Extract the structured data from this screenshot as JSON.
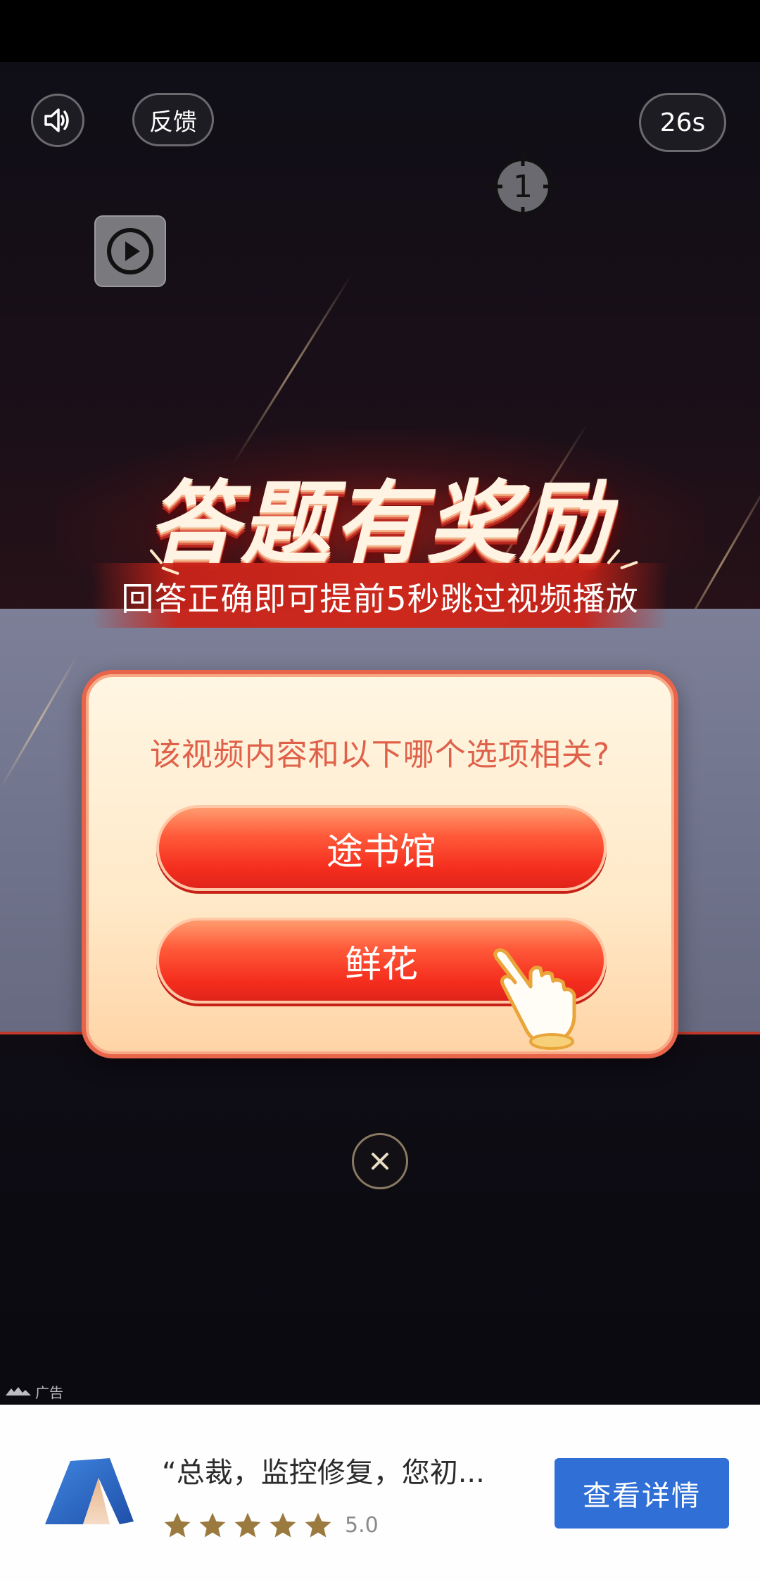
{
  "controls": {
    "sound_icon": "speaker-icon",
    "feedback_label": "反馈",
    "countdown": "26s",
    "target_marker_number": "1",
    "play_icon": "play-icon"
  },
  "headline": "答题有奖励",
  "subtitle": "回答正确即可提前5秒跳过视频播放",
  "quiz": {
    "question": "该视频内容和以下哪个选项相关?",
    "options": [
      "途书馆",
      "鲜花"
    ]
  },
  "close_icon": "close-icon",
  "ad_label": "广告",
  "ad_card": {
    "title": "“总裁，监控修复，您初...",
    "rating_value": "5.0",
    "rating_stars": 5,
    "details_button": "查看详情",
    "accent_color": "#2f6fd6",
    "star_color": "#9a7a3e"
  },
  "colors": {
    "modal_border": "#e8644a",
    "option_red": "#f52e1e",
    "question_text": "#e0614a"
  }
}
